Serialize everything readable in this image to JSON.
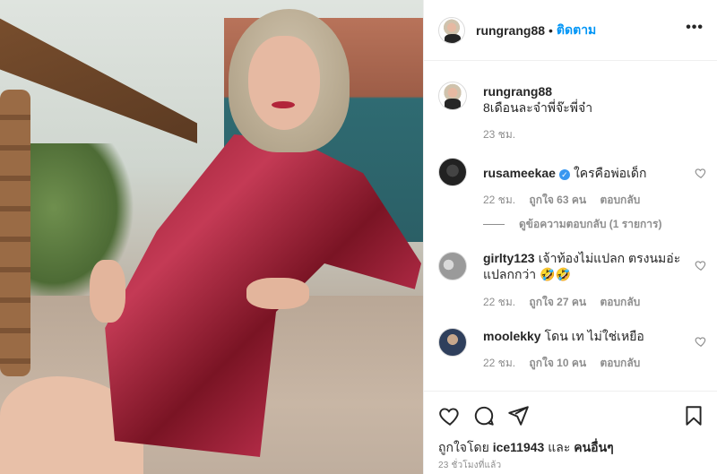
{
  "post": {
    "username": "rungrang88",
    "follow_label": "ติดตาม",
    "dot": "•",
    "more_label": "•••",
    "caption": "8เดือนละจ๋าพี่จ๊ะพี่จ๋า",
    "caption_time": "23 ชม."
  },
  "comments": [
    {
      "username": "rusameekae",
      "verified": true,
      "text": "ใครคือพ่อเด็ก",
      "time": "22 ชม.",
      "likes": "ถูกใจ 63 คน",
      "reply": "ตอบกลับ"
    },
    {
      "username": "girlty123",
      "verified": false,
      "text": "เจ้าท้องไม่แปลก ตรงนมอ่ะ แปลกกว่า 🤣🤣",
      "time": "22 ชม.",
      "likes": "ถูกใจ 27 คน",
      "reply": "ตอบกลับ"
    },
    {
      "username": "moolekky",
      "verified": false,
      "text": "โดน เท ไม่ใช่เหยือ",
      "time": "22 ชม.",
      "likes": "ถูกใจ 10 คน",
      "reply": "ตอบกลับ"
    }
  ],
  "view_replies": "ดูข้อความตอบกลับ (1 รายการ)",
  "likes_line": {
    "prefix": "ถูกใจโดย",
    "user": "ice11943",
    "middle": "และ",
    "others": "คนอื่นๆ"
  },
  "timestamp": "23 ชั่วโมงที่แล้ว",
  "icons": [
    "heart-icon",
    "comment-icon",
    "share-icon",
    "bookmark-icon"
  ],
  "colors": {
    "follow": "#0095f6",
    "verified": "#3897f0",
    "muted": "#8e8e8e"
  }
}
